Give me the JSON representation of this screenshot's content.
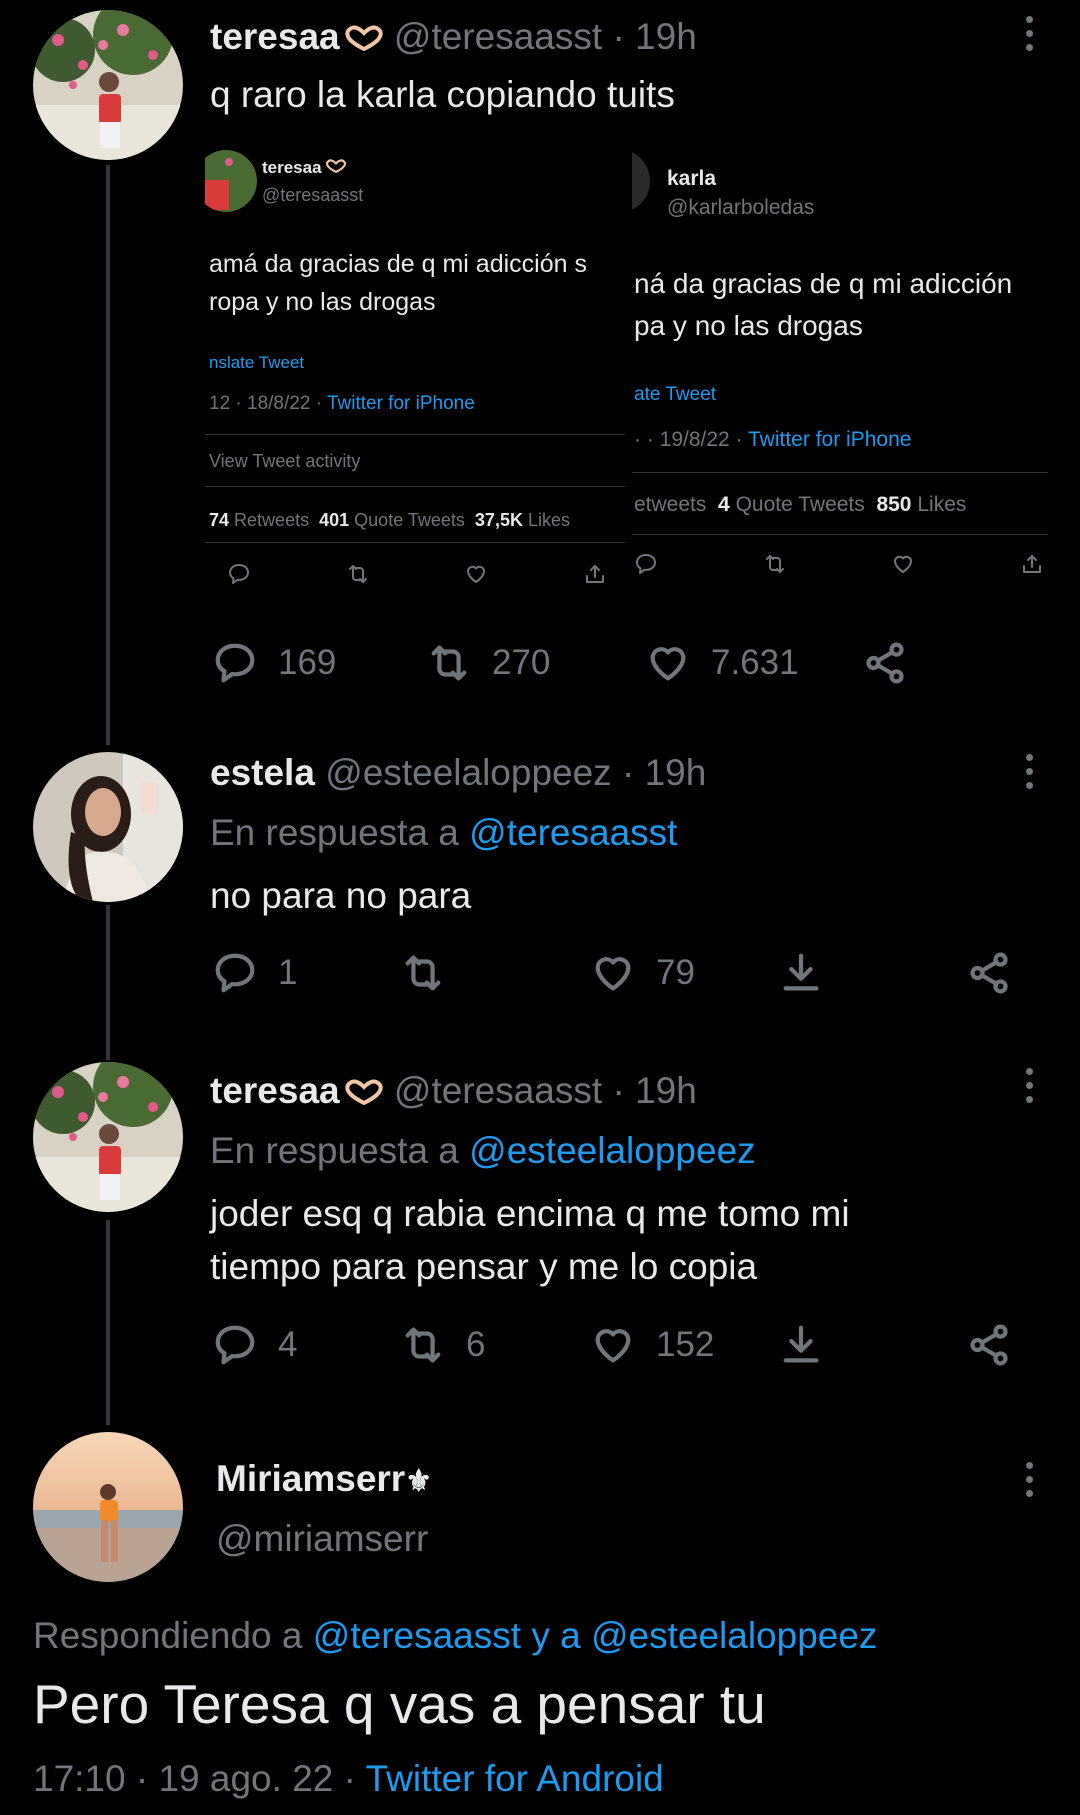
{
  "tweet1": {
    "name": "teresaa",
    "handle": "@teresaasst",
    "time": "· 19h",
    "text": "q raro la karla copiando tuits",
    "reply_count": "169",
    "retweet_count": "270",
    "like_count": "7.631"
  },
  "embed_left": {
    "name": "teresaa",
    "handle": "@teresaasst",
    "line1": "amá da gracias de q mi adicción s",
    "line2": "ropa y no las drogas",
    "translate": "nslate Tweet",
    "meta_time": "12 · 18/8/22 · ",
    "meta_source": "Twitter for iPhone",
    "activity": "View Tweet activity",
    "rt_num": "74",
    "rt_label": "Retweets",
    "qt_num": "401",
    "qt_label": "Quote Tweets",
    "likes_num": "37,5K",
    "likes_label": "Likes"
  },
  "embed_right": {
    "name": "karla",
    "handle": "@karlarboledas",
    "line1": "ná da gracias de q mi adicción",
    "line2": "pa y no las drogas",
    "translate": "ate Tweet",
    "meta_time": "· · 19/8/22 · ",
    "meta_source": "Twitter for iPhone",
    "rt_label": "etweets",
    "qt_num": "4",
    "qt_label": "Quote Tweets",
    "likes_num": "850",
    "likes_label": "Likes"
  },
  "tweet2": {
    "name": "estela",
    "handle": "@esteelaloppeez",
    "time": "· 19h",
    "reply_prefix": "En respuesta a ",
    "reply_to": "@teresaasst",
    "text": "no para no para",
    "reply_count": "1",
    "retweet_count": "",
    "like_count": "79"
  },
  "tweet3": {
    "name": "teresaa",
    "handle": "@teresaasst",
    "time": "· 19h",
    "reply_prefix": "En respuesta a ",
    "reply_to": "@esteelaloppeez",
    "text_line1": "joder esq q rabia encima q me tomo mi",
    "text_line2": "tiempo para pensar y me lo copia",
    "reply_count": "4",
    "retweet_count": "6",
    "like_count": "152"
  },
  "tweet4": {
    "name": "Miriamserr",
    "name_symbol": "⚜",
    "handle": "@miriamserr",
    "replying_prefix": "Respondiendo a ",
    "replying_to": "@teresaasst y a @esteelaloppeez",
    "text": "Pero Teresa q vas a pensar tu",
    "timestamp": "17:10 · 19 ago. 22 · ",
    "source": "Twitter for Android"
  },
  "colors": {
    "background": "#000000",
    "text": "#e7e9ea",
    "muted": "#71767b",
    "link": "#1d9bf0"
  }
}
